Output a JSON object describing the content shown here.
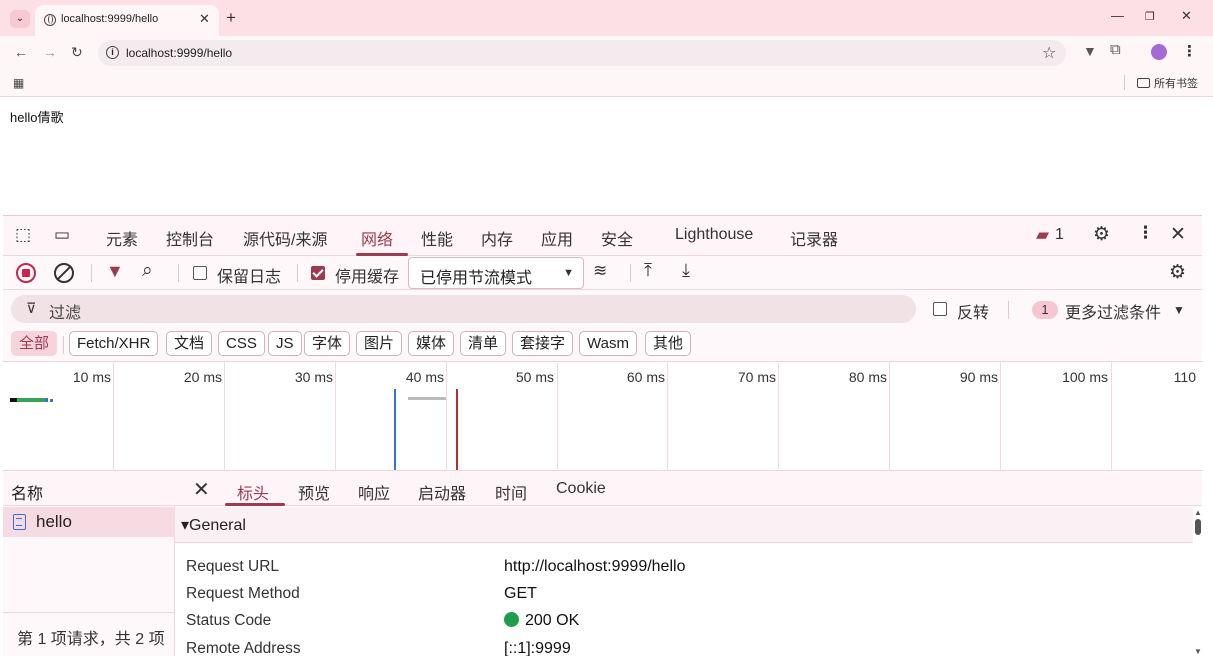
{
  "browser": {
    "tab_title": "localhost:9999/hello",
    "url": "localhost:9999/hello",
    "bookmarks_folder": "所有书签"
  },
  "page": {
    "text": "hello倩歌"
  },
  "devtools": {
    "tabs": [
      "元素",
      "控制台",
      "源代码/来源",
      "网络",
      "性能",
      "内存",
      "应用",
      "安全",
      "Lighthouse",
      "记录器"
    ],
    "active_tab": "网络",
    "issues_count": "1",
    "toolbar": {
      "preserve_log": "保留日志",
      "preserve_log_checked": false,
      "disable_cache": "停用缓存",
      "disable_cache_checked": true,
      "throttling": "已停用节流模式"
    },
    "filter": {
      "placeholder": "过滤",
      "invert": "反转",
      "more_filters_count": "1",
      "more_filters": "更多过滤条件"
    },
    "type_chips": [
      "全部",
      "Fetch/XHR",
      "文档",
      "CSS",
      "JS",
      "字体",
      "图片",
      "媒体",
      "清单",
      "套接字",
      "Wasm",
      "其他"
    ],
    "active_chip": "全部",
    "timeline_ticks": [
      "10 ms",
      "20 ms",
      "30 ms",
      "40 ms",
      "50 ms",
      "60 ms",
      "70 ms",
      "80 ms",
      "90 ms",
      "100 ms",
      "110"
    ],
    "requests": {
      "column": "名称",
      "items": [
        "hello"
      ],
      "summary": "第 1 项请求，共 2 项"
    },
    "detail": {
      "tabs": [
        "标头",
        "预览",
        "响应",
        "启动器",
        "时间",
        "Cookie"
      ],
      "active_tab": "标头",
      "section": "▾General",
      "rows": [
        {
          "key": "Request URL",
          "value": "http://localhost:9999/hello"
        },
        {
          "key": "Request Method",
          "value": "GET"
        },
        {
          "key": "Status Code",
          "value": "200 OK"
        },
        {
          "key": "Remote Address",
          "value": "[::1]:9999"
        }
      ]
    }
  },
  "colors": {
    "accent": "#9c3a4f",
    "chrome_bg": "#fde0e6",
    "status_ok": "#1e9e4a"
  }
}
